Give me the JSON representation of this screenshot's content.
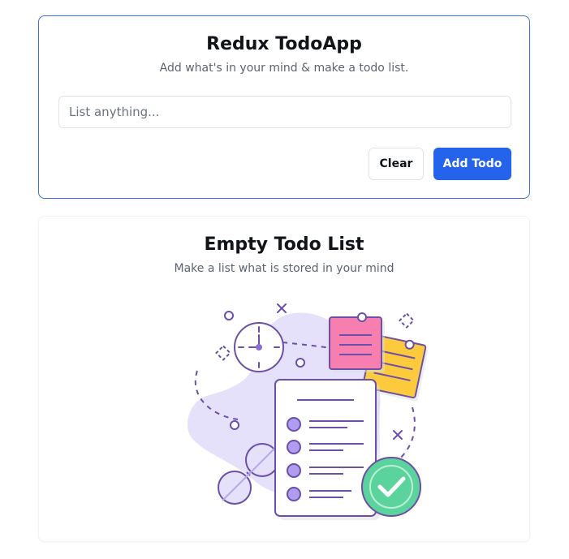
{
  "form": {
    "title": "Redux TodoApp",
    "subtitle": "Add what's in your mind & make a todo list.",
    "input_value": "",
    "input_placeholder": "List anything...",
    "clear_label": "Clear",
    "add_label": "Add Todo"
  },
  "empty_state": {
    "title": "Empty Todo List",
    "subtitle": "Make a list what is stored in your mind",
    "illustration_icon": "empty-todo-list-illustration"
  },
  "colors": {
    "accent": "#2563eb",
    "form_border": "#3b6fd8",
    "illustration_purple": "#6b4fa8",
    "illustration_lavender": "#e6e1fb",
    "note_pink": "#f67fb0",
    "note_yellow": "#fdca3d",
    "check_green": "#5ad49c"
  }
}
